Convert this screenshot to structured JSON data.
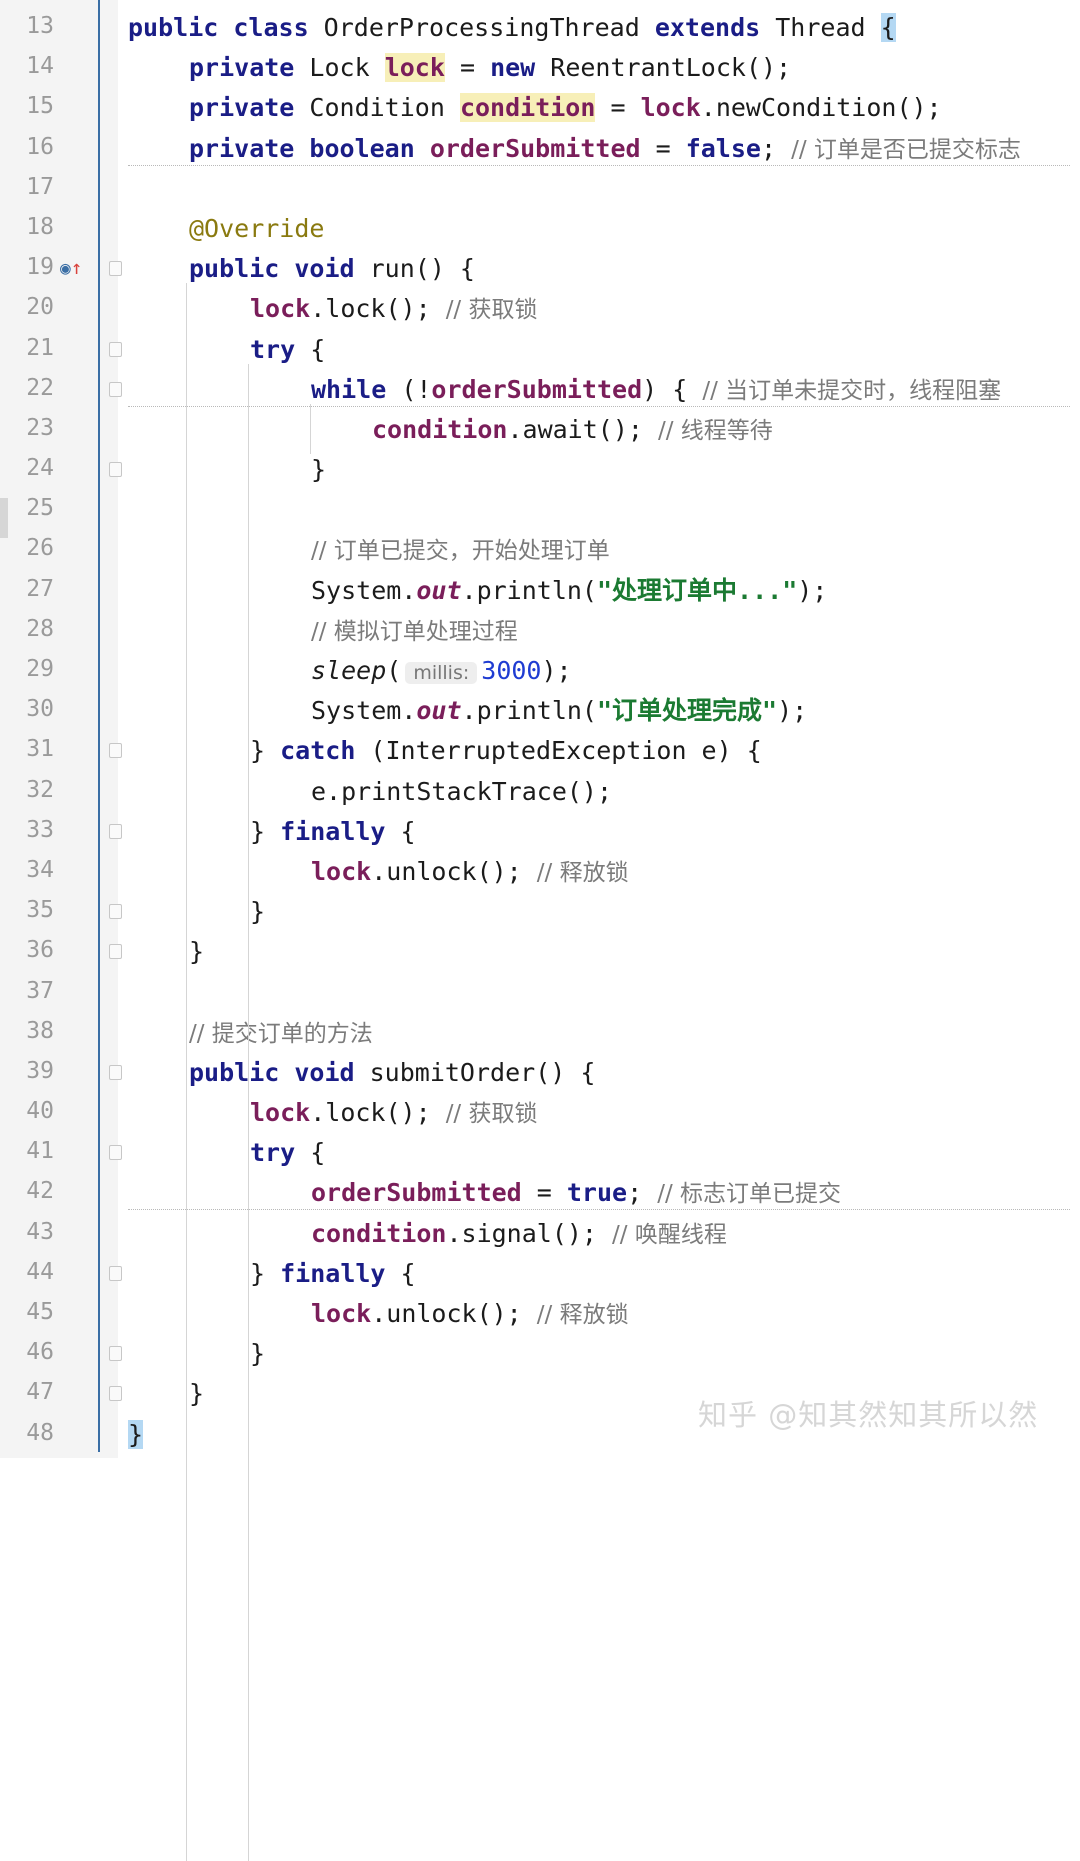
{
  "watermark": "知乎 @知其然知其所以然",
  "lines": [
    {
      "n": "13",
      "fold": false,
      "icon": "",
      "wavy": false,
      "indent": 0,
      "tokens": [
        [
          "kw",
          "public class "
        ],
        [
          "",
          "OrderProcessingThread "
        ],
        [
          "kw",
          "extends "
        ],
        [
          "",
          "Thread "
        ],
        [
          "hlb",
          "{"
        ]
      ]
    },
    {
      "n": "14",
      "fold": false,
      "icon": "",
      "wavy": false,
      "indent": 1,
      "tokens": [
        [
          "kw",
          "private "
        ],
        [
          "",
          "Lock "
        ],
        [
          "fld hl",
          "lock"
        ],
        [
          "",
          " = "
        ],
        [
          "kw",
          "new "
        ],
        [
          "",
          "ReentrantLock();"
        ]
      ]
    },
    {
      "n": "15",
      "fold": false,
      "icon": "",
      "wavy": false,
      "indent": 1,
      "tokens": [
        [
          "kw",
          "private "
        ],
        [
          "",
          "Condition "
        ],
        [
          "fld hl",
          "condition"
        ],
        [
          "",
          " = "
        ],
        [
          "fld",
          "lock"
        ],
        [
          "",
          ".newCondition();"
        ]
      ]
    },
    {
      "n": "16",
      "fold": false,
      "icon": "",
      "wavy": true,
      "indent": 1,
      "tokens": [
        [
          "kw",
          "private boolean "
        ],
        [
          "fld",
          "orderSubmitted"
        ],
        [
          "",
          " = "
        ],
        [
          "kw",
          "false"
        ],
        [
          "",
          "; "
        ],
        [
          "cmt",
          "// 订单是否已提交标志"
        ]
      ]
    },
    {
      "n": "17",
      "fold": false,
      "icon": "",
      "wavy": false,
      "indent": 0,
      "tokens": []
    },
    {
      "n": "18",
      "fold": false,
      "icon": "",
      "wavy": false,
      "indent": 1,
      "tokens": [
        [
          "ann",
          "@Override"
        ]
      ]
    },
    {
      "n": "19",
      "fold": true,
      "icon": "o↑",
      "wavy": false,
      "indent": 1,
      "tokens": [
        [
          "kw",
          "public void "
        ],
        [
          "",
          "run() {"
        ]
      ]
    },
    {
      "n": "20",
      "fold": false,
      "icon": "",
      "wavy": false,
      "indent": 2,
      "tokens": [
        [
          "fld",
          "lock"
        ],
        [
          "",
          ".lock(); "
        ],
        [
          "cmt",
          "// 获取锁"
        ]
      ]
    },
    {
      "n": "21",
      "fold": true,
      "icon": "",
      "wavy": false,
      "indent": 2,
      "tokens": [
        [
          "kw",
          "try "
        ],
        [
          "",
          "{"
        ]
      ]
    },
    {
      "n": "22",
      "fold": true,
      "icon": "",
      "wavy": true,
      "indent": 3,
      "tokens": [
        [
          "kw",
          "while "
        ],
        [
          "",
          "(!"
        ],
        [
          "fld",
          "orderSubmitted"
        ],
        [
          "",
          ") { "
        ],
        [
          "cmt",
          "// 当订单未提交时，线程阻塞"
        ]
      ]
    },
    {
      "n": "23",
      "fold": false,
      "icon": "",
      "wavy": false,
      "indent": 4,
      "tokens": [
        [
          "fld",
          "condition"
        ],
        [
          "",
          ".await(); "
        ],
        [
          "cmt",
          "// 线程等待"
        ]
      ]
    },
    {
      "n": "24",
      "fold": true,
      "icon": "",
      "wavy": false,
      "indent": 3,
      "tokens": [
        [
          "",
          "}"
        ]
      ]
    },
    {
      "n": "25",
      "fold": false,
      "icon": "",
      "wavy": false,
      "indent": 0,
      "tokens": []
    },
    {
      "n": "26",
      "fold": false,
      "icon": "",
      "wavy": false,
      "indent": 3,
      "tokens": [
        [
          "cmt",
          "// 订单已提交，开始处理订单"
        ]
      ]
    },
    {
      "n": "27",
      "fold": false,
      "icon": "",
      "wavy": false,
      "indent": 3,
      "tokens": [
        [
          "",
          "System."
        ],
        [
          "itl",
          "out"
        ],
        [
          "",
          ".println("
        ],
        [
          "str",
          "\"处理订单中...\""
        ],
        [
          "",
          ");"
        ]
      ]
    },
    {
      "n": "28",
      "fold": false,
      "icon": "",
      "wavy": false,
      "indent": 3,
      "tokens": [
        [
          "cmt",
          "// 模拟订单处理过程"
        ]
      ]
    },
    {
      "n": "29",
      "fold": false,
      "icon": "",
      "wavy": false,
      "indent": 3,
      "tokens": [
        [
          "itl-plain",
          "sleep"
        ],
        [
          "",
          "("
        ],
        [
          "hint",
          "millis:"
        ],
        [
          "num",
          "3000"
        ],
        [
          "",
          ");"
        ]
      ]
    },
    {
      "n": "30",
      "fold": false,
      "icon": "",
      "wavy": false,
      "indent": 3,
      "tokens": [
        [
          "",
          "System."
        ],
        [
          "itl",
          "out"
        ],
        [
          "",
          ".println("
        ],
        [
          "str",
          "\"订单处理完成\""
        ],
        [
          "",
          ");"
        ]
      ]
    },
    {
      "n": "31",
      "fold": true,
      "icon": "",
      "wavy": false,
      "indent": 2,
      "tokens": [
        [
          "",
          "} "
        ],
        [
          "kw",
          "catch "
        ],
        [
          "",
          "(InterruptedException e) {"
        ]
      ]
    },
    {
      "n": "32",
      "fold": false,
      "icon": "",
      "wavy": false,
      "indent": 3,
      "tokens": [
        [
          "",
          "e.printStackTrace();"
        ]
      ]
    },
    {
      "n": "33",
      "fold": true,
      "icon": "",
      "wavy": false,
      "indent": 2,
      "tokens": [
        [
          "",
          "} "
        ],
        [
          "kw",
          "finally "
        ],
        [
          "",
          "{"
        ]
      ]
    },
    {
      "n": "34",
      "fold": false,
      "icon": "",
      "wavy": false,
      "indent": 3,
      "tokens": [
        [
          "fld",
          "lock"
        ],
        [
          "",
          ".unlock(); "
        ],
        [
          "cmt",
          "// 释放锁"
        ]
      ]
    },
    {
      "n": "35",
      "fold": true,
      "icon": "",
      "wavy": false,
      "indent": 2,
      "tokens": [
        [
          "",
          "}"
        ]
      ]
    },
    {
      "n": "36",
      "fold": true,
      "icon": "",
      "wavy": false,
      "indent": 1,
      "tokens": [
        [
          "",
          "}"
        ]
      ]
    },
    {
      "n": "37",
      "fold": false,
      "icon": "",
      "wavy": false,
      "indent": 0,
      "tokens": []
    },
    {
      "n": "38",
      "fold": false,
      "icon": "",
      "wavy": false,
      "indent": 1,
      "tokens": [
        [
          "cmt",
          "// 提交订单的方法"
        ]
      ]
    },
    {
      "n": "39",
      "fold": true,
      "icon": "",
      "wavy": false,
      "indent": 1,
      "tokens": [
        [
          "kw",
          "public void "
        ],
        [
          "",
          "submitOrder() {"
        ]
      ]
    },
    {
      "n": "40",
      "fold": false,
      "icon": "",
      "wavy": false,
      "indent": 2,
      "tokens": [
        [
          "fld",
          "lock"
        ],
        [
          "",
          ".lock(); "
        ],
        [
          "cmt",
          "// 获取锁"
        ]
      ]
    },
    {
      "n": "41",
      "fold": true,
      "icon": "",
      "wavy": false,
      "indent": 2,
      "tokens": [
        [
          "kw",
          "try "
        ],
        [
          "",
          "{"
        ]
      ]
    },
    {
      "n": "42",
      "fold": false,
      "icon": "",
      "wavy": true,
      "indent": 3,
      "tokens": [
        [
          "fld",
          "orderSubmitted"
        ],
        [
          "",
          " = "
        ],
        [
          "kw",
          "true"
        ],
        [
          "",
          "; "
        ],
        [
          "cmt",
          "// 标志订单已提交"
        ]
      ]
    },
    {
      "n": "43",
      "fold": false,
      "icon": "",
      "wavy": false,
      "indent": 3,
      "tokens": [
        [
          "fld",
          "condition"
        ],
        [
          "",
          ".signal(); "
        ],
        [
          "cmt",
          "// 唤醒线程"
        ]
      ]
    },
    {
      "n": "44",
      "fold": true,
      "icon": "",
      "wavy": false,
      "indent": 2,
      "tokens": [
        [
          "",
          "} "
        ],
        [
          "kw",
          "finally "
        ],
        [
          "",
          "{"
        ]
      ]
    },
    {
      "n": "45",
      "fold": false,
      "icon": "",
      "wavy": false,
      "indent": 3,
      "tokens": [
        [
          "fld",
          "lock"
        ],
        [
          "",
          ".unlock(); "
        ],
        [
          "cmt",
          "// 释放锁"
        ]
      ]
    },
    {
      "n": "46",
      "fold": true,
      "icon": "",
      "wavy": false,
      "indent": 2,
      "tokens": [
        [
          "",
          "}"
        ]
      ]
    },
    {
      "n": "47",
      "fold": true,
      "icon": "",
      "wavy": false,
      "indent": 1,
      "tokens": [
        [
          "",
          "}"
        ]
      ]
    },
    {
      "n": "48",
      "fold": false,
      "icon": "",
      "wavy": false,
      "indent": 0,
      "tokens": [
        [
          "hlb",
          "}"
        ]
      ]
    }
  ]
}
